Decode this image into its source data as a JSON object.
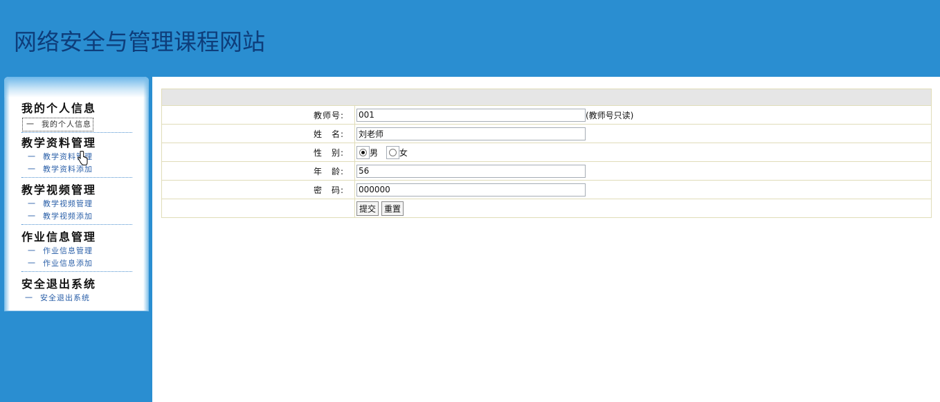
{
  "header": {
    "title": "网络安全与管理课程网站"
  },
  "sidebar": {
    "groups": [
      {
        "title": "我的个人信息",
        "items": [
          {
            "label": "我的个人信息"
          }
        ]
      },
      {
        "title": "教学资料管理",
        "items": [
          {
            "label": "教学资料管理"
          },
          {
            "label": "教学资料添加"
          }
        ]
      },
      {
        "title": "教学视频管理",
        "items": [
          {
            "label": "教学视频管理"
          },
          {
            "label": "教学视频添加"
          }
        ]
      },
      {
        "title": "作业信息管理",
        "items": [
          {
            "label": "作业信息管理"
          },
          {
            "label": "作业信息添加"
          }
        ]
      },
      {
        "title": "安全退出系统",
        "items": [
          {
            "label": "安全退出系统"
          }
        ]
      }
    ],
    "dash": "一"
  },
  "form": {
    "teacher_id": {
      "label": "教师号:",
      "value": "001",
      "hint": "(教师号只读)"
    },
    "name": {
      "label": "姓　名:",
      "value": "刘老师"
    },
    "gender": {
      "label": "性　别:",
      "options": [
        "男",
        "女"
      ],
      "selected": "男"
    },
    "age": {
      "label": "年　龄:",
      "value": "56"
    },
    "password": {
      "label": "密　码:",
      "value": "000000"
    },
    "submit_label": "提交",
    "reset_label": "重置"
  },
  "colors": {
    "header_bg": "#2a8ed1",
    "title_color": "#0e3d7a",
    "link_color": "#2a5fa8"
  }
}
